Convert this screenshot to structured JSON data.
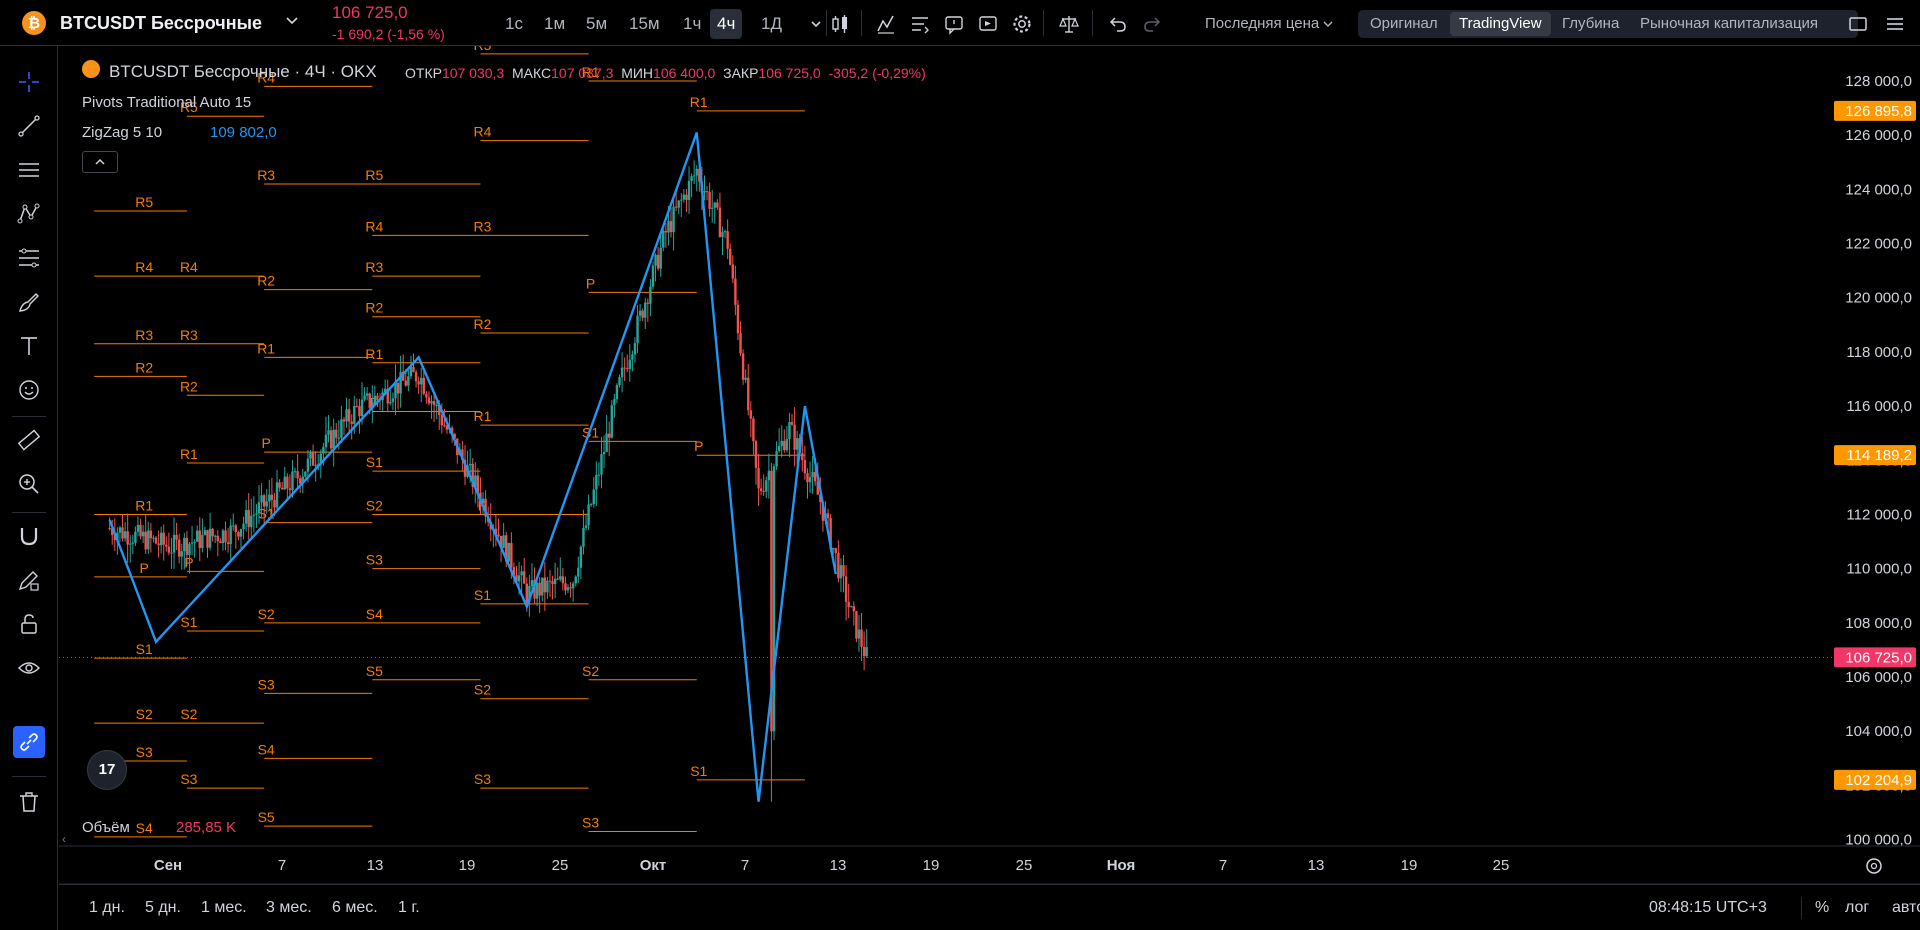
{
  "header": {
    "logo_glyph": "₿",
    "symbol": "BTCUSDT Бессрочные",
    "price": "106 725,0",
    "change": "-1 690,2 (-1,56 %)",
    "timeframes": [
      "1с",
      "1м",
      "5м",
      "15м",
      "1ч",
      "4ч",
      "1Д"
    ],
    "active_timeframe": "4ч",
    "price_source": "Последняя цена",
    "view_tabs": [
      "Оригинал",
      "TradingView",
      "Глубина",
      "Рыночная капитализация"
    ],
    "active_view": "TradingView"
  },
  "legend": {
    "title": "BTCUSDT Бессрочные · 4Ч · OKX",
    "open_label": "ОТКР",
    "open": "107 030,3",
    "high_label": "МАКС",
    "high": "107 037,3",
    "low_label": "МИН",
    "low": "106 400,0",
    "close_label": "ЗАКР",
    "close": "106 725,0",
    "change": "-305,2 (-0,29%)",
    "indicator1": "Pivots Traditional Auto 15",
    "indicator2": "ZigZag 5 10",
    "indicator2_value": "109 802,0",
    "volume_label": "Объём",
    "volume_value": "285,85 K",
    "badge": "17"
  },
  "colors": {
    "up": "#26a69a",
    "down": "#ef5350",
    "pivot": "#f57c00",
    "zigzag": "#2196f3",
    "price_tag": "#f23668",
    "pivot_tag": "#ff9800"
  },
  "price_axis": {
    "labels": [
      "128 000,0",
      "126 000,0",
      "124 000,0",
      "122 000,0",
      "120 000,0",
      "118 000,0",
      "116 000,0",
      "114 000,0",
      "112 000,0",
      "110 000,0",
      "108 000,0",
      "106 000,0",
      "104 000,0",
      "102 000,0",
      "100 000,0"
    ],
    "tags": [
      {
        "value": 126895.8,
        "text": "126 895,8",
        "kind": "pivot"
      },
      {
        "value": 114189.2,
        "text": "114 189,2",
        "kind": "pivot"
      },
      {
        "value": 106725.0,
        "text": "106 725,0",
        "kind": "price"
      },
      {
        "value": 102204.9,
        "text": "102 204,9",
        "kind": "pivot"
      }
    ]
  },
  "time_axis": [
    "Сен",
    "7",
    "13",
    "19",
    "25",
    "Окт",
    "7",
    "13",
    "19",
    "25",
    "Ноя",
    "7",
    "13",
    "19",
    "25"
  ],
  "bottom": {
    "ranges": [
      "1 дн.",
      "5 дн.",
      "1 мес.",
      "3 мес.",
      "6 мес.",
      "1 г."
    ],
    "clock": "08:48:15 UTC+3",
    "percent": "%",
    "log": "лог",
    "auto": "авто"
  },
  "chart_data": {
    "type": "candlestick",
    "ylim": [
      99000,
      129000
    ],
    "zigzag": [
      {
        "date": "Aug 29",
        "price": 111800
      },
      {
        "date": "Sep 1",
        "price": 107300
      },
      {
        "date": "Sep 18",
        "price": 117800
      },
      {
        "date": "Sep 25",
        "price": 108600
      },
      {
        "date": "Oct 6",
        "price": 126100
      },
      {
        "date": "Oct 10",
        "price": 101400
      },
      {
        "date": "Oct 13",
        "price": 116000
      },
      {
        "date": "Oct 15",
        "price": 109800
      }
    ],
    "pivot_periods": [
      {
        "levels": [
          [
            "R5",
            123200
          ],
          [
            "R4",
            120800
          ],
          [
            "R3",
            118300
          ],
          [
            "R2",
            117100
          ],
          [
            "R1",
            112000
          ],
          [
            "P",
            109700
          ],
          [
            "S1",
            106700
          ],
          [
            "S2",
            104300
          ],
          [
            "S3",
            102900
          ],
          [
            "S4",
            100100
          ]
        ]
      },
      {
        "levels": [
          [
            "R5",
            126700
          ],
          [
            "R4",
            120800
          ],
          [
            "R3",
            118300
          ],
          [
            "R2",
            116400
          ],
          [
            "R1",
            113900
          ],
          [
            "P",
            109900
          ],
          [
            "S1",
            107700
          ],
          [
            "S2",
            104300
          ],
          [
            "S3",
            101900
          ]
        ]
      },
      {
        "levels": [
          [
            "R4",
            127800
          ],
          [
            "R3",
            124200
          ],
          [
            "R2",
            120300
          ],
          [
            "R1",
            117800
          ],
          [
            "P",
            114300
          ],
          [
            "S1",
            111700
          ],
          [
            "S2",
            108000
          ],
          [
            "S3",
            105400
          ],
          [
            "S4",
            103000
          ],
          [
            "S5",
            100500
          ]
        ]
      },
      {
        "levels": [
          [
            "R5",
            124200
          ],
          [
            "R4",
            122300
          ],
          [
            "R3",
            120800
          ],
          [
            "R2",
            119300
          ],
          [
            "R1",
            117600
          ],
          [
            "P",
            115800
          ],
          [
            "S1",
            113600
          ],
          [
            "S2",
            112000
          ],
          [
            "S3",
            110000
          ],
          [
            "S4",
            108000
          ],
          [
            "S5",
            105900
          ]
        ]
      },
      {
        "levels": [
          [
            "R5",
            129000
          ],
          [
            "R4",
            125800
          ],
          [
            "R3",
            122300
          ],
          [
            "R2",
            118700
          ],
          [
            "R1",
            115300
          ],
          [
            "P",
            112000
          ],
          [
            "S1",
            108700
          ],
          [
            "S2",
            105200
          ],
          [
            "S3",
            101900
          ]
        ]
      },
      {
        "levels": [
          [
            "R1",
            128000
          ],
          [
            "P",
            120200
          ],
          [
            "S1",
            114700
          ],
          [
            "S2",
            105900
          ],
          [
            "S3",
            100300
          ]
        ]
      },
      {
        "levels": [
          [
            "R1",
            126896
          ],
          [
            "P",
            114189
          ],
          [
            "S1",
            102205
          ]
        ]
      }
    ],
    "pivot_period_dates": [
      "Aug 29 – Sep 2",
      "Sep 2 – Sep 7",
      "Sep 7 – Sep 14",
      "Sep 14 – Sep 21",
      "Sep 21 – Sep 29",
      "Sep 29 – Oct 9",
      "Oct 9 – Oct 20"
    ],
    "candles_summary": [
      {
        "date": "Aug 29",
        "close": 111500
      },
      {
        "date": "Sep 2",
        "close": 110800
      },
      {
        "date": "Sep 6",
        "close": 111400
      },
      {
        "date": "Sep 10",
        "close": 113300
      },
      {
        "date": "Sep 14",
        "close": 115900
      },
      {
        "date": "Sep 18",
        "close": 117200
      },
      {
        "date": "Sep 22",
        "close": 112700
      },
      {
        "date": "Sep 25",
        "close": 109100
      },
      {
        "date": "Sep 28",
        "close": 109600
      },
      {
        "date": "Oct 1",
        "close": 116800
      },
      {
        "date": "Oct 4",
        "close": 122400
      },
      {
        "date": "Oct 6",
        "close": 124700
      },
      {
        "date": "Oct 8",
        "close": 122000
      },
      {
        "date": "Oct 10",
        "close": 112800
      },
      {
        "date": "Oct 12",
        "close": 115200
      },
      {
        "date": "Oct 14",
        "close": 112500
      },
      {
        "date": "Oct 16",
        "close": 108300
      },
      {
        "date": "Oct 17",
        "close": 106725
      }
    ]
  }
}
